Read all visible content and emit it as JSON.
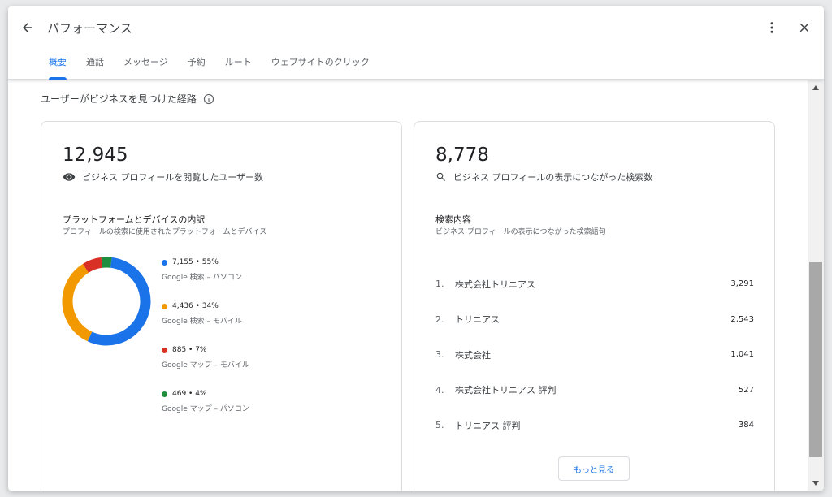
{
  "header": {
    "title": "パフォーマンス",
    "back_icon": "arrow-back-icon",
    "more_icon": "more-vert-icon",
    "close_icon": "close-icon"
  },
  "tabs": [
    {
      "label": "概要",
      "active": true
    },
    {
      "label": "通話",
      "active": false
    },
    {
      "label": "メッセージ",
      "active": false
    },
    {
      "label": "予約",
      "active": false
    },
    {
      "label": "ルート",
      "active": false
    },
    {
      "label": "ウェブサイトのクリック",
      "active": false
    }
  ],
  "section": {
    "title": "ユーザーがビジネスを見つけた経路"
  },
  "views_card": {
    "total": "12,945",
    "metric_label": "ビジネス プロフィールを閲覧したユーザー数",
    "breakdown_title": "プラットフォームとデバイスの内訳",
    "breakdown_desc": "プロフィールの検索に使用されたプラットフォームとデバイス",
    "legend": [
      {
        "value": "7,155 • 55%",
        "label": "Google 検索 – パソコン",
        "color": "#1a73e8",
        "percent": 55
      },
      {
        "value": "4,436 • 34%",
        "label": "Google 検索 – モバイル",
        "color": "#f29900",
        "percent": 34
      },
      {
        "value": "885 • 7%",
        "label": "Google マップ – モバイル",
        "color": "#d93025",
        "percent": 7
      },
      {
        "value": "469 • 4%",
        "label": "Google マップ – パソコン",
        "color": "#1e8e3e",
        "percent": 4
      }
    ]
  },
  "search_card": {
    "total": "8,778",
    "metric_label": "ビジネス プロフィールの表示につながった検索数",
    "queries_title": "検索内容",
    "queries_desc": "ビジネス プロフィールの表示につながった検索語句",
    "queries": [
      {
        "rank": "1.",
        "term": "株式会社トリニアス",
        "count": "3,291"
      },
      {
        "rank": "2.",
        "term": "トリニアス",
        "count": "2,543"
      },
      {
        "rank": "3.",
        "term": "株式会社",
        "count": "1,041"
      },
      {
        "rank": "4.",
        "term": "株式会社トリニアス 評判",
        "count": "527"
      },
      {
        "rank": "5.",
        "term": "トリニアス 評判",
        "count": "384"
      }
    ],
    "more_label": "もっと見る"
  }
}
